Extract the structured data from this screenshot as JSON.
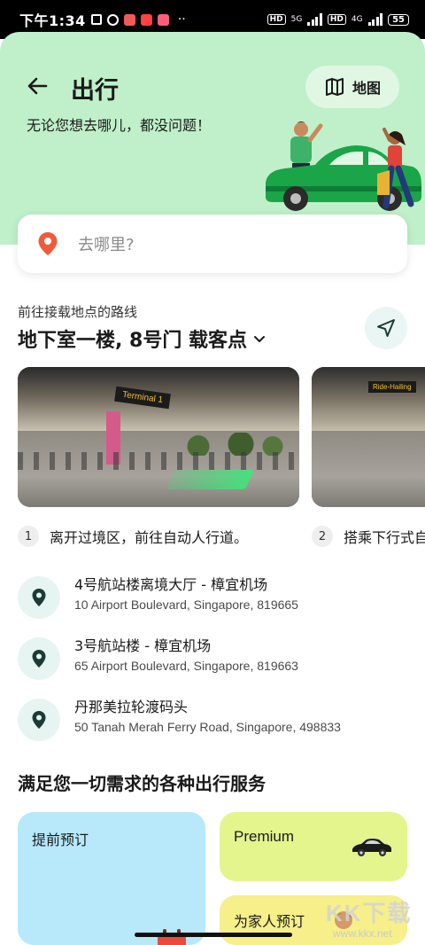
{
  "status_bar": {
    "time": "下午1:34",
    "hd1": "HD",
    "net1": "5G",
    "hd2": "HD",
    "net2": "4G",
    "battery": "55"
  },
  "header": {
    "title": "出行",
    "map_label": "地图",
    "subtitle": "无论您想去哪儿，都没问题！"
  },
  "search": {
    "placeholder": "去哪里?"
  },
  "route": {
    "label": "前往接载地点的路线",
    "title": "地下室一楼, 8号门 载客点"
  },
  "photos": {
    "sign1": "Terminal 1",
    "sign2": "Ride-Hailing"
  },
  "steps": [
    {
      "num": "1",
      "text": "离开过境区，前往自动人行道。"
    },
    {
      "num": "2",
      "text": "搭乘下行式自"
    }
  ],
  "locations": [
    {
      "name": "4号航站楼离境大厅 - 樟宜机场",
      "address": "10 Airport Boulevard, Singapore, 819665"
    },
    {
      "name": "3号航站楼 - 樟宜机场",
      "address": "65 Airport Boulevard, Singapore, 819663"
    },
    {
      "name": "丹那美拉轮渡码头",
      "address": "50 Tanah Merah Ferry Road, Singapore, 498833"
    }
  ],
  "services": {
    "title": "满足您一切需求的各种出行服务",
    "cards": [
      {
        "label": "提前预订"
      },
      {
        "label": "Premium"
      },
      {
        "label": "为家人预订"
      }
    ]
  },
  "watermark": {
    "text": "KK下载",
    "url": "www.kkx.net"
  },
  "colors": {
    "hero_bg": "#bff0c9",
    "pin_red": "#f15a3a",
    "pin_dark": "#1d3b36",
    "card_blue": "#b7e9fb",
    "card_lime": "#e3f58c",
    "card_yellow": "#f6ef8a"
  }
}
